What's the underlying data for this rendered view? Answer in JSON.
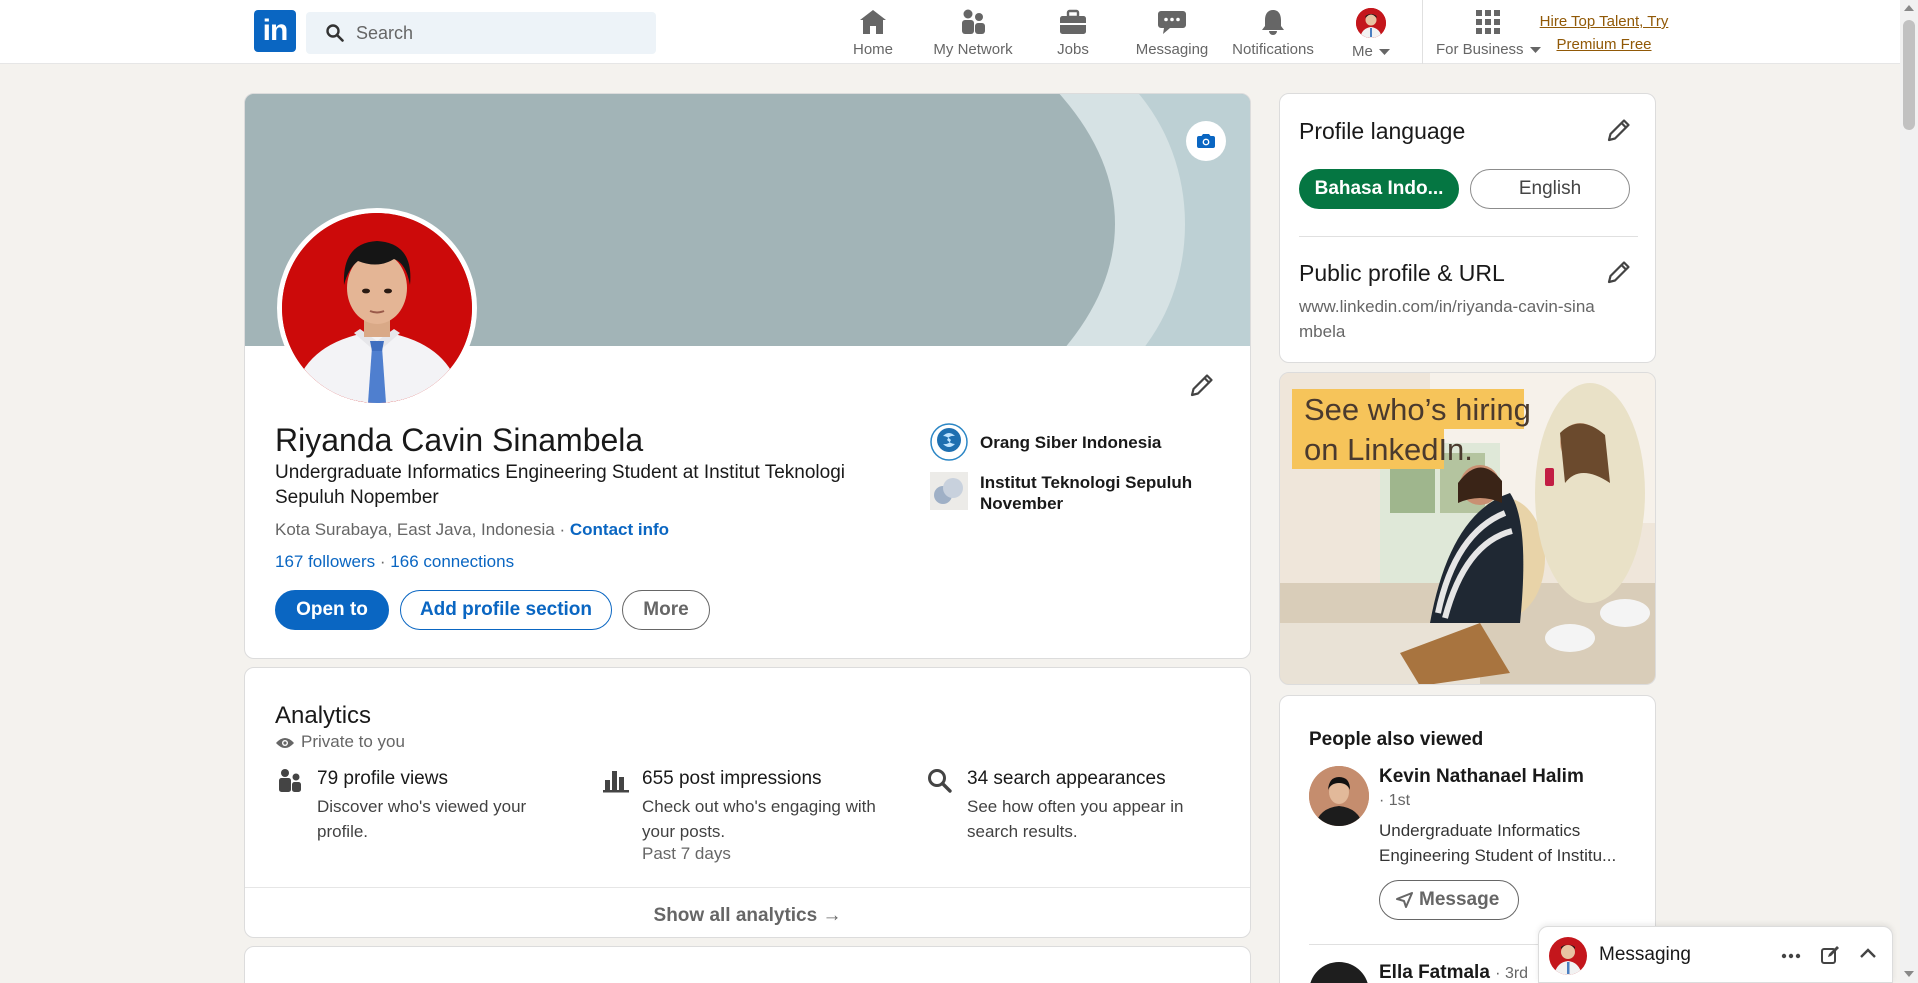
{
  "nav": {
    "logo_text": "in",
    "search_placeholder": "Search",
    "items": [
      {
        "label": "Home",
        "icon": "home-icon"
      },
      {
        "label": "My Network",
        "icon": "network-icon"
      },
      {
        "label": "Jobs",
        "icon": "briefcase-icon"
      },
      {
        "label": "Messaging",
        "icon": "chat-icon"
      },
      {
        "label": "Notifications",
        "icon": "bell-icon"
      },
      {
        "label": "Me",
        "icon": "avatar"
      },
      {
        "label": "For Business",
        "icon": "grid-icon"
      }
    ],
    "premium_line1": "Hire Top Talent, Try",
    "premium_line2": "Premium Free"
  },
  "profile": {
    "name": "Riyanda Cavin Sinambela",
    "headline": "Undergraduate Informatics Engineering Student at Institut Teknologi Sepuluh Nopember",
    "location": "Kota Surabaya, East Java, Indonesia",
    "location_sep": " · ",
    "contact_info": "Contact info",
    "followers": "167 followers",
    "connections_sep": " · ",
    "connections": "166 connections",
    "buttons": {
      "open_to": "Open to",
      "add_section": "Add profile section",
      "more": "More"
    },
    "orgs": [
      {
        "name": "Orang Siber Indonesia"
      },
      {
        "name": "Institut Teknologi Sepuluh November"
      }
    ]
  },
  "analytics": {
    "title": "Analytics",
    "privacy": "Private to you",
    "stats": [
      {
        "title": "79 profile views",
        "desc": "Discover who's viewed your profile.",
        "note": "",
        "icon": "people-icon"
      },
      {
        "title": "655 post impressions",
        "desc": "Check out who's engaging with your posts.",
        "note": "Past 7 days",
        "icon": "bar-chart-icon"
      },
      {
        "title": "34 search appearances",
        "desc": "See how often you appear in search results.",
        "note": "",
        "icon": "search-icon"
      }
    ],
    "show_all": "Show all analytics →"
  },
  "sidebar": {
    "profile_language": "Profile language",
    "lang_active": "Bahasa Indo...",
    "lang_inactive": "English",
    "public_profile": "Public profile & URL",
    "url": "www.linkedin.com/in/riyanda-cavin-sinambela"
  },
  "ad": {
    "line1": "See who’s hiring",
    "line2": "on LinkedIn."
  },
  "people_also_viewed": {
    "title": "People also viewed",
    "people": [
      {
        "name": "Kevin Nathanael Halim",
        "degree": "· 1st",
        "headline": "Undergraduate Informatics Engineering Student of Institu...",
        "action": "Message"
      },
      {
        "name": "Ella Fatmala",
        "degree": "· 3rd",
        "headline": "",
        "action": ""
      }
    ]
  },
  "messaging_bar": {
    "label": "Messaging"
  },
  "colors": {
    "brand": "#0a66c2",
    "active_lang": "#057642",
    "premium": "#915907"
  }
}
